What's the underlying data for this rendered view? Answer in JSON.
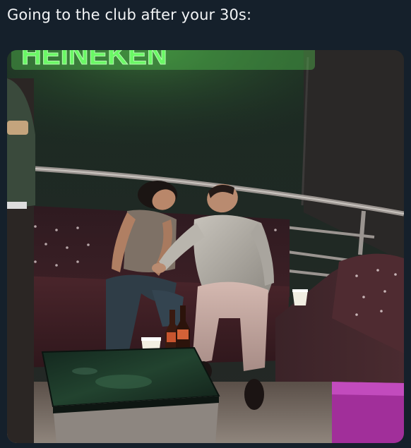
{
  "post": {
    "caption": "Going to the club after your 30s:"
  },
  "colors": {
    "background": "#15202b",
    "caption_text": "#f2f4f6",
    "neon_green": "#4dff52",
    "sofa_maroon": "#3a1c22",
    "table_top_green": "#1d3a2c"
  },
  "photo": {
    "neon_sign_text": "HEINEKEN"
  }
}
